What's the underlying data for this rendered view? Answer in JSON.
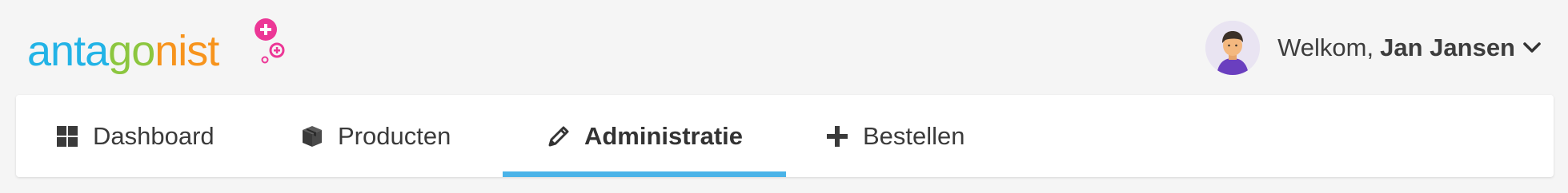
{
  "header": {
    "logo": {
      "text": "antagonist",
      "letters": [
        "a",
        "n",
        "t",
        "a",
        "g",
        "o",
        "n",
        "i",
        "s",
        "t"
      ],
      "letter_colors": [
        "#22b3e6",
        "#22b3e6",
        "#22b3e6",
        "#22b3e6",
        "#8cc63f",
        "#8cc63f",
        "#f7941d",
        "#f7941d",
        "#f7941d",
        "#f7941d"
      ],
      "accent_color": "#ec3796"
    },
    "user": {
      "greeting": "Welkom,",
      "name": "Jan Jansen",
      "avatar_icon": "user-avatar",
      "dropdown_icon": "chevron-down-icon"
    }
  },
  "nav": {
    "tabs": [
      {
        "label": "Dashboard",
        "icon": "grid-icon",
        "active": false
      },
      {
        "label": "Producten",
        "icon": "box-icon",
        "active": false
      },
      {
        "label": "Administratie",
        "icon": "pencil-icon",
        "active": true
      },
      {
        "label": "Bestellen",
        "icon": "plus-icon",
        "active": false
      }
    ],
    "active_indicator_color": "#4ab3e8"
  }
}
